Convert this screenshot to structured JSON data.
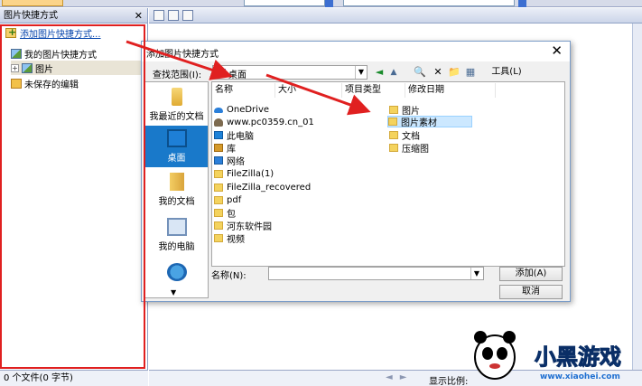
{
  "left_pane": {
    "title": "图片快捷方式",
    "close_glyph": "✕",
    "add_shortcut_label": "添加图片快捷方式...",
    "tree": [
      {
        "label": "我的图片快捷方式",
        "icon": "picture-shortcut-icon"
      },
      {
        "label": "图片",
        "icon": "picture-icon",
        "expander": "+"
      },
      {
        "label": "未保存的编辑",
        "icon": "edit-icon"
      }
    ],
    "status": "0 个文件(0 字节)"
  },
  "main_status": {
    "ratio_label": "显示比例:"
  },
  "dialog": {
    "title": "添加图片快捷方式",
    "close_glyph": "✕",
    "lookin_label": "查找范围(I):",
    "lookin_value": "桌面",
    "toolbar": {
      "back": "◄",
      "up": "▲",
      "search": "🔍",
      "delete": "✕",
      "newfolder": "📁",
      "view": "▦",
      "tools": "工具(L)"
    },
    "places": [
      {
        "label": "我最近的文档",
        "icon": "recent-docs-icon",
        "active": false
      },
      {
        "label": "桌面",
        "icon": "desktop-icon",
        "active": true
      },
      {
        "label": "我的文档",
        "icon": "my-documents-icon",
        "active": false
      },
      {
        "label": "我的电脑",
        "icon": "my-computer-icon",
        "active": false
      },
      {
        "label": "",
        "icon": "network-icon",
        "active": false
      }
    ],
    "columns": [
      "名称",
      "大小",
      "项目类型",
      "修改日期"
    ],
    "items_left": [
      {
        "name": "OneDrive",
        "icon": "cloud"
      },
      {
        "name": "www.pc0359.cn_01",
        "icon": "user"
      },
      {
        "name": "此电脑",
        "icon": "pc"
      },
      {
        "name": "库",
        "icon": "lib"
      },
      {
        "name": "网络",
        "icon": "net"
      },
      {
        "name": "FileZilla(1)",
        "icon": "folder"
      },
      {
        "name": "FileZilla_recovered",
        "icon": "folder"
      },
      {
        "name": "pdf",
        "icon": "folder"
      },
      {
        "name": "包",
        "icon": "folder"
      },
      {
        "name": "河东软件园",
        "icon": "folder"
      },
      {
        "name": "视频",
        "icon": "folder"
      }
    ],
    "items_right": [
      {
        "name": "图片",
        "icon": "folder",
        "selected": false
      },
      {
        "name": "图片素材",
        "icon": "folder",
        "selected": true
      },
      {
        "name": "文档",
        "icon": "folder",
        "selected": false
      },
      {
        "name": "压缩图",
        "icon": "folder",
        "selected": false
      }
    ],
    "filename_label": "名称(N):",
    "filename_value": "",
    "add_button": "添加(A)",
    "cancel_button": "取消"
  },
  "watermark": {
    "text": "小黑游戏",
    "url": "www.xiaohei.com"
  },
  "colors": {
    "highlight_red": "#e02020",
    "place_active": "#1979ca",
    "selection": "#cce8ff"
  }
}
